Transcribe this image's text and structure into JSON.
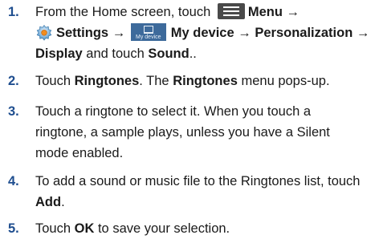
{
  "steps": [
    {
      "number": "1.",
      "line1_a": "From the Home screen, touch",
      "menu_label": "Menu",
      "arrow": "→",
      "settings_label": "Settings",
      "my_device_icon_text": "My device",
      "my_device_label": "My device",
      "personalization_label": "Personalization",
      "display_label": "Display",
      "and_touch": "and touch",
      "sound_label": "Sound",
      "line3_end": ".."
    },
    {
      "number": "2.",
      "touch": "Touch",
      "ringtones_label": "Ringtones",
      "middle": ". The",
      "ringtones_label2": "Ringtones",
      "end": "menu pops-up."
    },
    {
      "number": "3.",
      "line1": "Touch a ringtone to select it. When you touch a",
      "line2": "ringtone, a sample plays, unless you have a Silent",
      "line3": "mode enabled."
    },
    {
      "number": "4.",
      "line1": "To add a sound or music file to the Ringtones list, touch",
      "add_label": "Add",
      "add_end": "."
    },
    {
      "number": "5.",
      "touch": "Touch",
      "ok_label": "OK",
      "end": "to save your selection."
    }
  ],
  "icons": {
    "menu": "menu-icon",
    "settings": "settings-gear-icon",
    "my_device": "my-device-tab-icon"
  }
}
